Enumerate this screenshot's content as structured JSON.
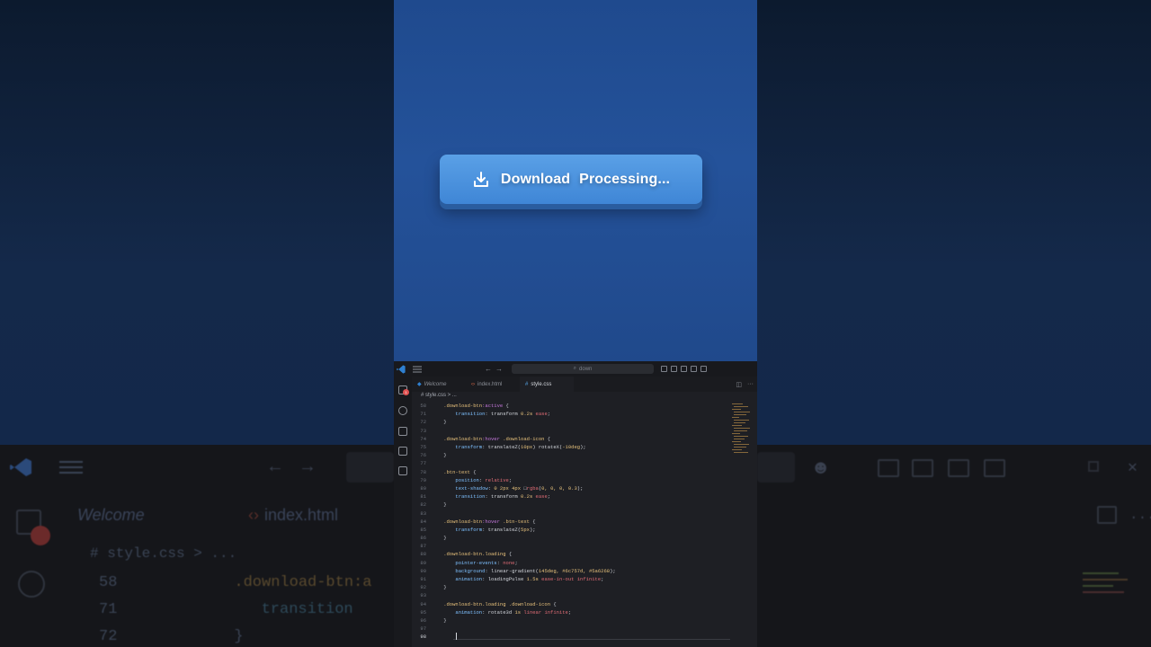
{
  "preview": {
    "button_label": "Download",
    "button_status": "Processing...",
    "icon": "download-icon"
  },
  "editor": {
    "search_placeholder": "down",
    "tabs": [
      {
        "label": "Welcome",
        "icon": "vscode-icon"
      },
      {
        "label": "index.html",
        "icon": "html-icon"
      },
      {
        "label": "style.css",
        "icon": "css-icon",
        "active": true,
        "unsaved": true
      }
    ],
    "breadcrumb": "# style.css > ...",
    "badge": "1",
    "lines": [
      {
        "n": "58",
        "parts": [
          [
            "sel",
            "    .download-btn"
          ],
          [
            "pc",
            ":active"
          ],
          [
            "punc",
            " {"
          ]
        ]
      },
      {
        "n": "71",
        "parts": [
          [
            "prop",
            "        transition"
          ],
          [
            "punc",
            ": "
          ],
          [
            "txt",
            "transform "
          ],
          [
            "val",
            "0.2s"
          ],
          [
            "kw",
            " ease"
          ],
          [
            "punc",
            ";"
          ]
        ]
      },
      {
        "n": "72",
        "parts": [
          [
            "punc",
            "    }"
          ]
        ]
      },
      {
        "n": "73",
        "parts": []
      },
      {
        "n": "74",
        "parts": [
          [
            "sel",
            "    .download-btn"
          ],
          [
            "pc",
            ":hover"
          ],
          [
            "sel",
            " .download-icon"
          ],
          [
            "punc",
            " {"
          ]
        ]
      },
      {
        "n": "75",
        "parts": [
          [
            "prop",
            "        transform"
          ],
          [
            "punc",
            ": "
          ],
          [
            "txt",
            "translateZ("
          ],
          [
            "val",
            "10px"
          ],
          [
            "txt",
            ") rotateX("
          ],
          [
            "val",
            "-10deg"
          ],
          [
            "txt",
            ");"
          ]
        ]
      },
      {
        "n": "76",
        "parts": [
          [
            "punc",
            "    }"
          ]
        ]
      },
      {
        "n": "77",
        "parts": []
      },
      {
        "n": "78",
        "parts": [
          [
            "sel",
            "    .btn-text"
          ],
          [
            "punc",
            " {"
          ]
        ]
      },
      {
        "n": "79",
        "parts": [
          [
            "prop",
            "        position"
          ],
          [
            "punc",
            ": "
          ],
          [
            "kw",
            "relative"
          ],
          [
            "punc",
            ";"
          ]
        ]
      },
      {
        "n": "80",
        "parts": [
          [
            "prop",
            "        text-shadow"
          ],
          [
            "punc",
            ": "
          ],
          [
            "val",
            "0 2px 4px "
          ],
          [
            "txt",
            "□"
          ],
          [
            "kw",
            "rgba"
          ],
          [
            "txt",
            "("
          ],
          [
            "val",
            "0, 0, 0, 0.3"
          ],
          [
            "txt",
            ");"
          ]
        ]
      },
      {
        "n": "81",
        "parts": [
          [
            "prop",
            "        transition"
          ],
          [
            "punc",
            ": "
          ],
          [
            "txt",
            "transform "
          ],
          [
            "val",
            "0.2s"
          ],
          [
            "kw",
            " ease"
          ],
          [
            "punc",
            ";"
          ]
        ]
      },
      {
        "n": "82",
        "parts": [
          [
            "punc",
            "    }"
          ]
        ]
      },
      {
        "n": "83",
        "parts": []
      },
      {
        "n": "84",
        "parts": [
          [
            "sel",
            "    .download-btn"
          ],
          [
            "pc",
            ":hover"
          ],
          [
            "sel",
            " .btn-text"
          ],
          [
            "punc",
            " {"
          ]
        ]
      },
      {
        "n": "85",
        "parts": [
          [
            "prop",
            "        transform"
          ],
          [
            "punc",
            ": "
          ],
          [
            "txt",
            "translateZ("
          ],
          [
            "val",
            "5px"
          ],
          [
            "txt",
            ");"
          ]
        ]
      },
      {
        "n": "86",
        "parts": [
          [
            "punc",
            "    }"
          ]
        ]
      },
      {
        "n": "87",
        "parts": []
      },
      {
        "n": "88",
        "parts": [
          [
            "sel",
            "    .download-btn.loading"
          ],
          [
            "punc",
            " {"
          ]
        ]
      },
      {
        "n": "89",
        "parts": [
          [
            "prop",
            "        pointer-events"
          ],
          [
            "punc",
            ": "
          ],
          [
            "kw",
            "none"
          ],
          [
            "punc",
            ";"
          ]
        ]
      },
      {
        "n": "90",
        "parts": [
          [
            "prop",
            "        background"
          ],
          [
            "punc",
            ": "
          ],
          [
            "txt",
            "linear-gradient("
          ],
          [
            "val",
            "145deg, #6c757d, #5a6268"
          ],
          [
            "txt",
            ");"
          ]
        ]
      },
      {
        "n": "91",
        "parts": [
          [
            "prop",
            "        animation"
          ],
          [
            "punc",
            ": "
          ],
          [
            "txt",
            "loadingPulse "
          ],
          [
            "val",
            "1.5s"
          ],
          [
            "kw",
            " ease-in-out infinite"
          ],
          [
            "punc",
            ";"
          ]
        ]
      },
      {
        "n": "92",
        "parts": [
          [
            "punc",
            "    }"
          ]
        ]
      },
      {
        "n": "93",
        "parts": []
      },
      {
        "n": "94",
        "parts": [
          [
            "sel",
            "    .download-btn.loading"
          ],
          [
            "sel",
            " .download-icon"
          ],
          [
            "punc",
            " {"
          ]
        ]
      },
      {
        "n": "95",
        "parts": [
          [
            "prop",
            "        animation"
          ],
          [
            "punc",
            ": "
          ],
          [
            "txt",
            "rotate3d "
          ],
          [
            "val",
            "1s"
          ],
          [
            "kw",
            " linear infinite"
          ],
          [
            "punc",
            ";"
          ]
        ]
      },
      {
        "n": "96",
        "parts": [
          [
            "punc",
            "    }"
          ]
        ]
      },
      {
        "n": "97",
        "parts": []
      },
      {
        "n": "98",
        "parts": [],
        "current": true
      }
    ]
  },
  "background": {
    "tab_welcome": "Welcome",
    "tab_index": "index.html",
    "breadcrumb": "# style.css > ...",
    "lines": [
      {
        "n": "58",
        "code": ".download-btn:a"
      },
      {
        "n": "71",
        "code": "    transition"
      },
      {
        "n": "72",
        "code": "}"
      }
    ]
  }
}
